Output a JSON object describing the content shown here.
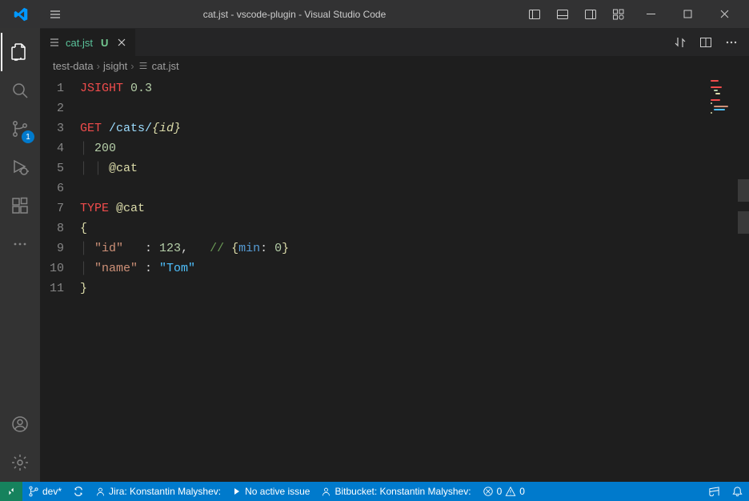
{
  "window": {
    "title": "cat.jst - vscode-plugin - Visual Studio Code"
  },
  "activitybar": {
    "scm_badge": "1"
  },
  "tab": {
    "filename": "cat.jst",
    "status": "U"
  },
  "breadcrumb": {
    "seg1": "test-data",
    "seg2": "jsight",
    "seg3": "cat.jst"
  },
  "code": {
    "lines": [
      "1",
      "2",
      "3",
      "4",
      "5",
      "6",
      "7",
      "8",
      "9",
      "10",
      "11"
    ],
    "l1_kw": "JSIGHT",
    "l1_ver": "0.3",
    "l3_kw": "GET",
    "l3_path": "/cats/",
    "l3_param": "{id}",
    "l4_status": "200",
    "l5_ref": "@cat",
    "l7_kw": "TYPE",
    "l7_ref": "@cat",
    "l8_brace": "{",
    "l9_key": "\"id\"",
    "l9_colon": "   : ",
    "l9_val": "123",
    "l9_comma": ",",
    "l9_comment": "// ",
    "l9_ann_open": "{",
    "l9_ann_key": "min",
    "l9_ann_colon": ": ",
    "l9_ann_val": "0",
    "l9_ann_close": "}",
    "l10_key": "\"name\"",
    "l10_colon": " : ",
    "l10_val": "\"Tom\"",
    "l11_brace": "}"
  },
  "status": {
    "branch": "dev*",
    "jira": "Jira: Konstantin Malyshev:",
    "issue": "No active issue",
    "bitbucket": "Bitbucket: Konstantin Malyshev:",
    "errors": "0",
    "warnings": "0"
  }
}
